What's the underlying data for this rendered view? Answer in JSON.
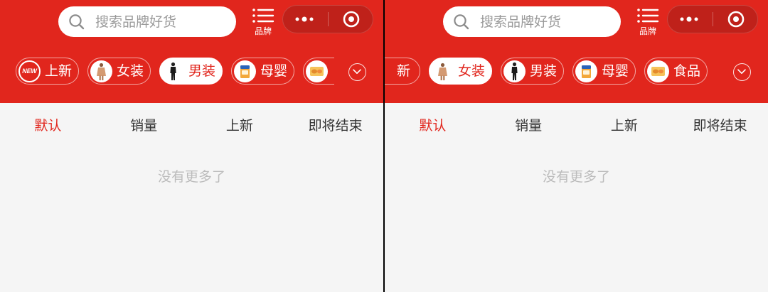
{
  "colors": {
    "brand_red": "#e1261d",
    "capsule_bg": "#bf211a",
    "page_bg": "#f5f5f5",
    "placeholder": "#9a9a9a",
    "tab_text": "#333333",
    "empty_text": "#bcbcbc"
  },
  "panels": [
    {
      "search": {
        "placeholder": "搜索品牌好货",
        "icon": "search-icon"
      },
      "brand_entry": {
        "label": "品牌",
        "icon": "list-icon"
      },
      "capsule": {
        "more_icon": "more-dots-icon",
        "close_icon": "target-icon"
      },
      "categories": [
        {
          "label": "上新",
          "badge": "NEW",
          "icon": "new-badge-icon",
          "selected": false
        },
        {
          "label": "女装",
          "icon": "womens-clothing-icon",
          "selected": false
        },
        {
          "label": "男装",
          "icon": "mens-clothing-icon",
          "selected": true
        },
        {
          "label": "母婴",
          "icon": "baby-products-icon",
          "selected": false
        },
        {
          "icon": "food-icon",
          "selected": false
        }
      ],
      "expand_icon": "chevron-down-icon",
      "sort_tabs": [
        {
          "label": "默认",
          "active": true
        },
        {
          "label": "销量",
          "active": false
        },
        {
          "label": "上新",
          "active": false
        },
        {
          "label": "即将结束",
          "active": false
        }
      ],
      "empty_text": "没有更多了"
    },
    {
      "search": {
        "placeholder": "搜索品牌好货",
        "icon": "search-icon"
      },
      "brand_entry": {
        "label": "品牌",
        "icon": "list-icon"
      },
      "capsule": {
        "more_icon": "more-dots-icon",
        "close_icon": "target-icon"
      },
      "categories": [
        {
          "label": "新",
          "selected": false
        },
        {
          "label": "女装",
          "icon": "womens-clothing-icon",
          "selected": true
        },
        {
          "label": "男装",
          "icon": "mens-clothing-icon",
          "selected": false
        },
        {
          "label": "母婴",
          "icon": "baby-products-icon",
          "selected": false
        },
        {
          "label": "食品",
          "icon": "food-icon",
          "selected": false
        }
      ],
      "expand_icon": "chevron-down-icon",
      "sort_tabs": [
        {
          "label": "默认",
          "active": true
        },
        {
          "label": "销量",
          "active": false
        },
        {
          "label": "上新",
          "active": false
        },
        {
          "label": "即将结束",
          "active": false
        }
      ],
      "empty_text": "没有更多了"
    }
  ]
}
